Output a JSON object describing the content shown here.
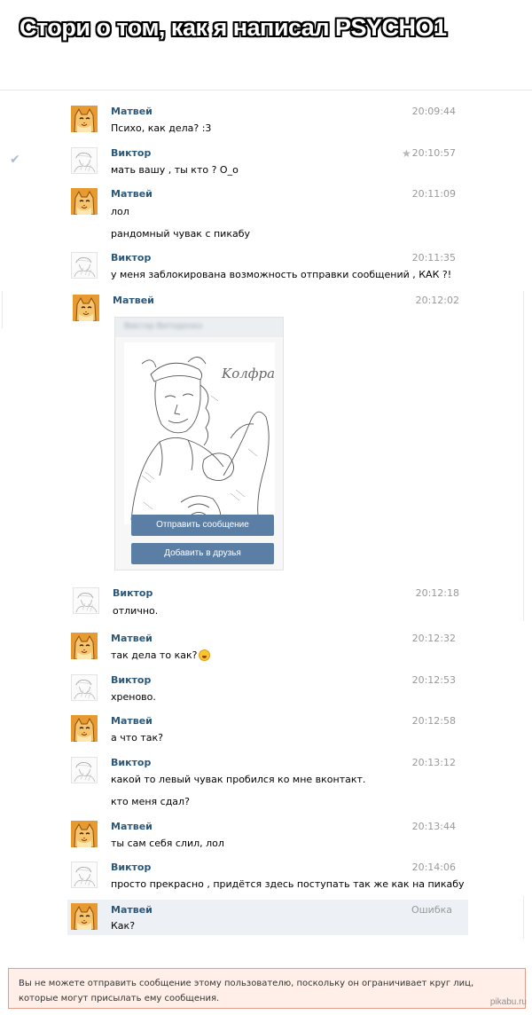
{
  "header": {
    "title": "Стори  о том, как я написал PSYCHO1"
  },
  "messages": [
    {
      "author": "Матвей",
      "time": "20:09:44",
      "lines": [
        "Психо, как дела? :3"
      ]
    },
    {
      "author": "Виктор",
      "time": "20:10:57",
      "lines": [
        "мать вашу , ты кто ? О_о"
      ]
    },
    {
      "author": "Матвей",
      "time": "20:11:09",
      "lines": [
        "лол",
        "рандомный чувак с пикабу"
      ]
    },
    {
      "author": "Виктор",
      "time": "20:11:35",
      "lines": [
        "у меня заблокирована возможность отправки сообщений , КАК ?!"
      ]
    },
    {
      "author": "Матвей",
      "time": "20:12:02",
      "lines": []
    },
    {
      "author": "Виктор",
      "time": "20:12:18",
      "lines": [
        "отлично."
      ]
    },
    {
      "author": "Матвей",
      "time": "20:12:32",
      "lines": [
        "так дела то как?"
      ]
    },
    {
      "author": "Виктор",
      "time": "20:12:53",
      "lines": [
        "хреново."
      ]
    },
    {
      "author": "Матвей",
      "time": "20:12:58",
      "lines": [
        "а что так?"
      ]
    },
    {
      "author": "Виктор",
      "time": "20:13:12",
      "lines": [
        "какой то левый чувак пробился ко мне вконтакт.",
        "кто меня сдал?"
      ]
    },
    {
      "author": "Матвей",
      "time": "20:13:44",
      "lines": [
        "ты сам себя слил, лол"
      ]
    },
    {
      "author": "Виктор",
      "time": "20:14:06",
      "lines": [
        "просто прекрасно , придётся здесь поступать так же как на пикабу"
      ]
    },
    {
      "author": "Матвей",
      "time": "Ошибка",
      "lines": [
        "Как?"
      ]
    }
  ],
  "profile_card": {
    "name": "Виктор Витоденко",
    "signature": "Kолфрах",
    "send_button": "Отправить сообщение",
    "add_friend_button": "Добавить в друзья"
  },
  "icons": {
    "read": "checkmark-icon",
    "important": "star-icon",
    "smile": "laughing-emoji-icon"
  },
  "error": {
    "text": "Вы не можете отправить сообщение этому пользователю, поскольку он ограничивает круг лиц, которые могут присылать ему сообщения."
  },
  "watermark": "pikabu.ru",
  "colors": {
    "author": "#2b587a",
    "time": "#999999",
    "button": "#5b7ea4",
    "highlight": "#edf1f5",
    "error_bg": "#ffefe8",
    "error_border": "#e89b88"
  }
}
